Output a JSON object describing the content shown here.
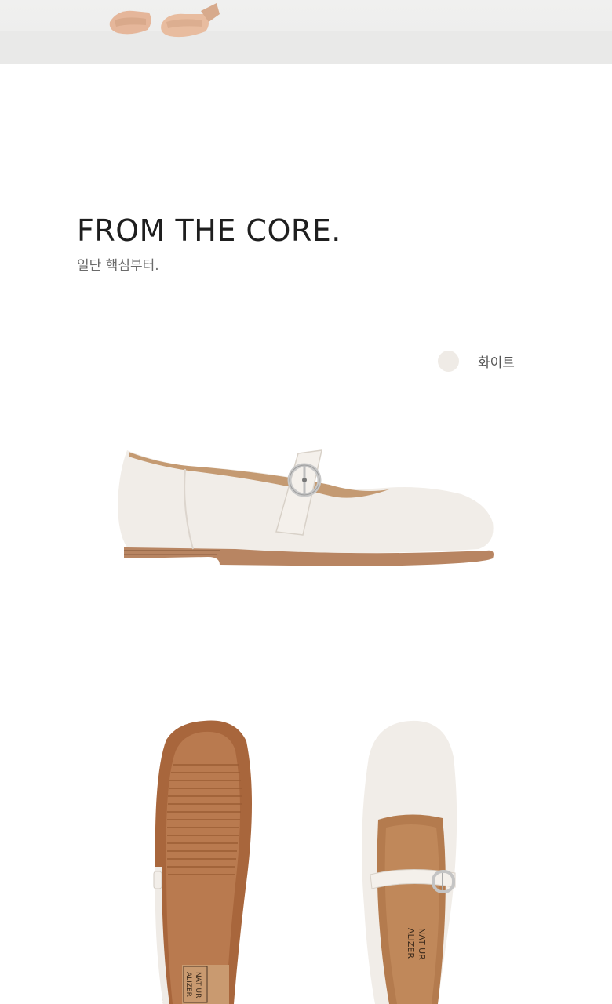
{
  "hero": {
    "image": "sandals-on-feet"
  },
  "section": {
    "headline": "FROM THE CORE.",
    "subhead": "일단 핵심부터."
  },
  "product": {
    "colors": [
      {
        "label": "화이트",
        "swatch": "#efebe6"
      }
    ],
    "logo_text": "NATURALIZER"
  }
}
